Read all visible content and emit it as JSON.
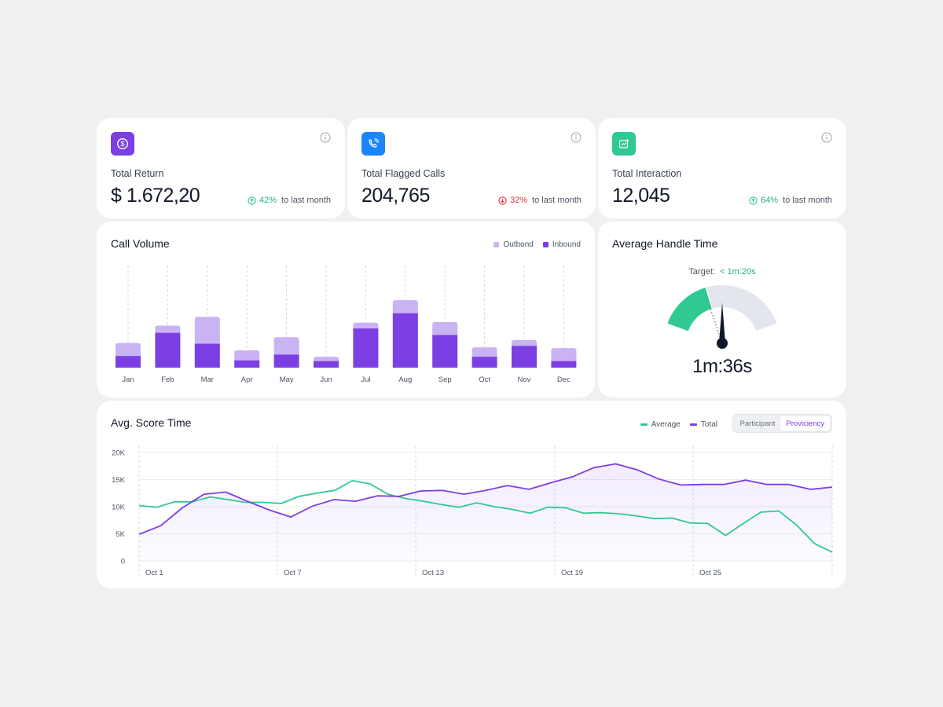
{
  "colors": {
    "purple": "#7b3fe4",
    "purple_light": "#c9b3f3",
    "green": "#2fc991",
    "red": "#e5343d",
    "blue": "#1a85ff",
    "gray_track": "#e3e6ec"
  },
  "stats": [
    {
      "icon": "dollar-circle-icon",
      "icon_color": "#7b3fe4",
      "label": "Total Return",
      "value": "$ 1.672,20",
      "change": "42%",
      "direction": "up",
      "suffix": "to last month"
    },
    {
      "icon": "phone-call-icon",
      "icon_color": "#1a85ff",
      "label": "Total Flagged Calls",
      "value": "204,765",
      "change": "32%",
      "direction": "down",
      "suffix": "to last month"
    },
    {
      "icon": "interaction-icon",
      "icon_color": "#2fc991",
      "label": "Total Interaction",
      "value": "12,045",
      "change": "64%",
      "direction": "up",
      "suffix": "to last month"
    }
  ],
  "call_volume": {
    "title": "Call Volume",
    "legend": {
      "outbound": "Outbond",
      "inbound": "Inbound"
    }
  },
  "handle_time": {
    "title": "Average Handle Time",
    "target_label": "Target:",
    "target_value": "< 1m:20s",
    "value": "1m:36s",
    "gauge_fill_fraction": 0.38
  },
  "score_time": {
    "title": "Avg. Score Time",
    "legend": {
      "average": "Average",
      "total": "Total"
    },
    "toggle": {
      "participant": "Participant",
      "proficiency": "Proviciency",
      "active": "proficiency"
    }
  },
  "chart_data": [
    {
      "type": "bar",
      "title": "Call Volume",
      "categories": [
        "Jan",
        "Feb",
        "Mar",
        "Apr",
        "May",
        "Jun",
        "Jul",
        "Aug",
        "Sep",
        "Oct",
        "Nov",
        "Dec"
      ],
      "stacked": true,
      "series": [
        {
          "name": "Inbound",
          "values": [
            16,
            48,
            33,
            10,
            18,
            9,
            54,
            75,
            45,
            15,
            30,
            9
          ]
        },
        {
          "name": "Outbond",
          "values": [
            18,
            10,
            37,
            14,
            24,
            6,
            8,
            18,
            18,
            13,
            8,
            18
          ]
        }
      ],
      "ylim": [
        0,
        130
      ],
      "legend": "top-right"
    },
    {
      "type": "line",
      "title": "Avg. Score Time",
      "x_labels": [
        "Oct 1",
        "Oct 7",
        "Oct 13",
        "Oct 19",
        "Oct 25"
      ],
      "yticks": [
        "0",
        "5K",
        "10K",
        "15K",
        "20K"
      ],
      "ylim": [
        0,
        20000
      ],
      "x": [
        1,
        2,
        3,
        4,
        5,
        5.6,
        6,
        6.5,
        7,
        8,
        8.6,
        9,
        10,
        11,
        12,
        13,
        13.7,
        15,
        16,
        17,
        17.6,
        18,
        19,
        19.8,
        21,
        21.6,
        22,
        23,
        24,
        24.6,
        25,
        26,
        27,
        28,
        28.8,
        29.8,
        30.8,
        32,
        33
      ],
      "series": [
        {
          "name": "Average",
          "values": [
            10200,
            9900,
            10900,
            10900,
            11800,
            11300,
            10800,
            10800,
            10600,
            11900,
            12500,
            13000,
            14800,
            14200,
            12300,
            11500,
            11000,
            10400,
            9900,
            10700,
            10000,
            9500,
            8800,
            9900,
            9800,
            8800,
            8900,
            8700,
            8300,
            7800,
            7900,
            7000,
            6900,
            4700,
            6900,
            9000,
            9200,
            6600,
            3200,
            1600
          ]
        },
        {
          "name": "Total",
          "values": [
            4900,
            6500,
            9800,
            12300,
            12700,
            11000,
            9400,
            8100,
            10100,
            11300,
            11000,
            12000,
            11900,
            12900,
            13000,
            12300,
            13000,
            13900,
            13200,
            14400,
            15500,
            17200,
            17900,
            16800,
            15100,
            14000,
            14100,
            14100,
            14900,
            14100,
            14100,
            13200,
            13600
          ]
        }
      ],
      "grid": true,
      "legend": "top-right"
    }
  ]
}
